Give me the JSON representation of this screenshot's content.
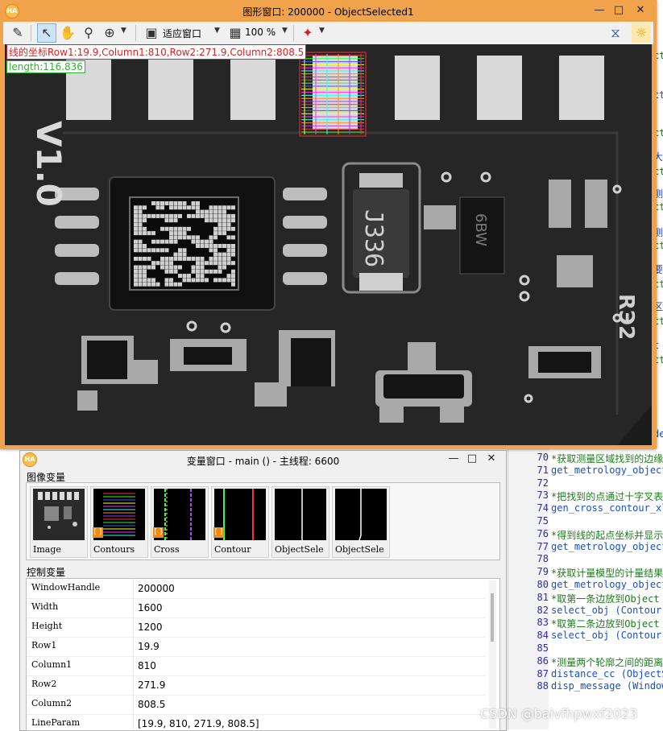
{
  "editor": {
    "rows": [
      {
        "n": "70",
        "t": "*获取测量区域找到的边缘",
        "c": "cmt"
      },
      {
        "n": "71",
        "t": "get_metrology_object_",
        "c": "fn"
      },
      {
        "n": "72",
        "t": "",
        "c": "fn"
      },
      {
        "n": "73",
        "t": "*把找到的点通过十字叉表",
        "c": "cmt"
      },
      {
        "n": "74",
        "t": "gen_cross_contour_xld",
        "c": "fn"
      },
      {
        "n": "75",
        "t": "",
        "c": "fn"
      },
      {
        "n": "76",
        "t": "*得到线的起点坐标并显示",
        "c": "cmt"
      },
      {
        "n": "77",
        "t": "get_metrology_object_",
        "c": "fn"
      },
      {
        "n": "78",
        "t": "",
        "c": "fn"
      },
      {
        "n": "79",
        "t": "*获取计量模型的计量结果",
        "c": "cmt"
      },
      {
        "n": "80",
        "t": "get_metrology_object_",
        "c": "fn"
      },
      {
        "n": "81",
        "t": "*取第一条边放到Object",
        "c": "cmt"
      },
      {
        "n": "82",
        "t": "select_obj (Contour,",
        "c": "fn"
      },
      {
        "n": "83",
        "t": "*取第二条边放到Object",
        "c": "cmt"
      },
      {
        "n": "84",
        "t": "select_obj (Contour,",
        "c": "fn"
      },
      {
        "n": "85",
        "t": "",
        "c": "fn"
      },
      {
        "n": "86",
        "t": "*测量两个轮廓之间的距离",
        "c": "cmt"
      },
      {
        "n": "87",
        "t": "distance_cc (ObjectSe",
        "c": "fn"
      },
      {
        "n": "88",
        "t": "disp_message (WindowH",
        "c": "fn"
      }
    ],
    "fragments": [
      "ct",
      "ct",
      "ct",
      "大",
      "ct",
      "测",
      "ct",
      "测",
      "ct",
      "要",
      "ct",
      "区",
      "ct",
      "t",
      "ct",
      "de"
    ]
  },
  "graphics_window": {
    "title": "图形窗口: 200000 - ObjectSelected1",
    "zoom_fit_label": "适应窗口",
    "zoom_percent": "100 %",
    "overlay_coords": "线的坐标Row1:19.9,Column1:810,Row2:271.9,Column2:808.5",
    "overlay_length": "length:116.836",
    "board_label": "V1.0",
    "chip_text": "J336",
    "chip2_text": "6BW",
    "marking": "RЭ2"
  },
  "variable_window": {
    "title": "变量窗口 - main () - 主线程: 6600",
    "image_section": "图像变量",
    "control_section": "控制变量",
    "thumbs": [
      {
        "name": "Image"
      },
      {
        "name": "Contours"
      },
      {
        "name": "Cross"
      },
      {
        "name": "Contour"
      },
      {
        "name": "ObjectSele"
      },
      {
        "name": "ObjectSele"
      }
    ],
    "controls": [
      {
        "k": "WindowHandle",
        "v": "200000"
      },
      {
        "k": "Width",
        "v": "1600"
      },
      {
        "k": "Height",
        "v": "1200"
      },
      {
        "k": "Row1",
        "v": "19.9"
      },
      {
        "k": "Column1",
        "v": "810"
      },
      {
        "k": "Row2",
        "v": "271.9"
      },
      {
        "k": "Column2",
        "v": "808.5"
      },
      {
        "k": "LineParam",
        "v": "[19.9, 810, 271.9, 808.5]"
      }
    ]
  },
  "watermark": "CSDN @baivfhpwxf2023",
  "colors": {
    "window_frame": "#f0a34b",
    "overlay_red": "#e02020",
    "overlay_green": "#2db52d",
    "pcb": "#232323"
  }
}
